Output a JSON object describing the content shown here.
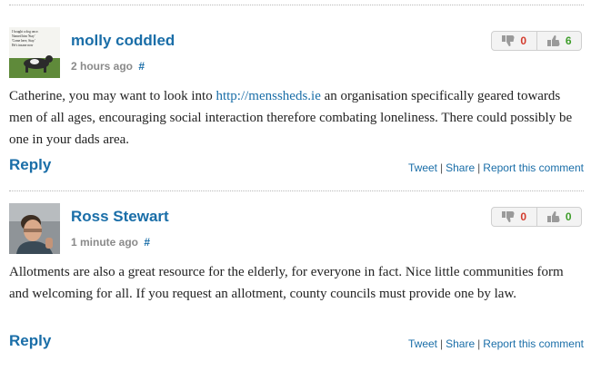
{
  "comments": [
    {
      "author": "molly coddled",
      "time": "2 hours ago",
      "permalink": "#",
      "avatar_caption": "I bought a dog once. Named him 'Stay' 'Come here, Stay.' He's insane now",
      "votes": {
        "down": "0",
        "up": "6"
      },
      "text_before": "Catherine, you may want to look into ",
      "link": "http://menssheds.ie",
      "text_after": " an organisation specifically geared towards men of all ages, encouraging social interaction therefore combating loneliness. There could possibly be one in your dads area.",
      "reply": "Reply",
      "actions": {
        "tweet": "Tweet",
        "share": "Share",
        "report": "Report this comment",
        "sep": "|"
      }
    },
    {
      "author": "Ross Stewart",
      "time": "1 minute ago",
      "permalink": "#",
      "votes": {
        "down": "0",
        "up": "0"
      },
      "text": "Allotments are also a great resource for the elderly, for everyone in fact. Nice little communities form and welcoming for all. If you request an allotment, county councils must provide one by law.",
      "reply": "Reply",
      "actions": {
        "tweet": "Tweet",
        "share": "Share",
        "report": "Report this comment",
        "sep": "|"
      }
    }
  ],
  "colors": {
    "link": "#1a6ea8",
    "downvote": "#d33a2c",
    "upvote": "#3e9d2a",
    "meta": "#8a8a8a"
  },
  "icons": {
    "down": "thumbs-down-icon",
    "up": "thumbs-up-icon"
  }
}
